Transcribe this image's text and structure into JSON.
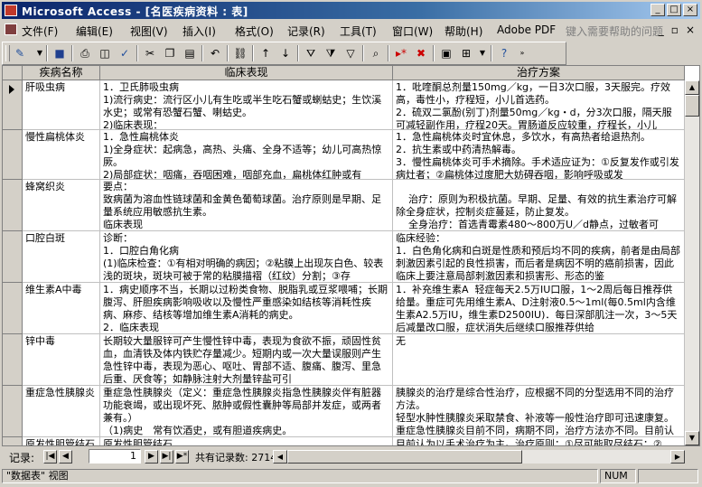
{
  "window": {
    "title": "Microsoft Access - [名医疾病资料 : 表]"
  },
  "menu": [
    "文件(F)",
    "编辑(E)",
    "视图(V)",
    "插入(I)",
    "格式(O)",
    "记录(R)",
    "工具(T)",
    "窗口(W)",
    "帮助(H)",
    "Adobe PDF"
  ],
  "help_placeholder": "键入需要帮助的问题",
  "toolbar": {
    "icons": [
      "design-view-icon",
      "save-icon",
      "print-icon",
      "print-preview-icon",
      "spelling-icon",
      "cut-icon",
      "copy-icon",
      "paste-icon",
      "undo-icon",
      "hyperlink-icon",
      "sort-ascending-icon",
      "sort-descending-icon",
      "filter-by-selection-icon",
      "filter-by-form-icon",
      "apply-filter-icon",
      "find-icon",
      "new-record-icon",
      "delete-record-icon",
      "database-window-icon",
      "new-object-icon",
      "help-icon"
    ]
  },
  "table": {
    "columns": [
      "疾病名称",
      "临床表现",
      "治疗方案"
    ],
    "rows": [
      {
        "name": "肝吸虫病",
        "clinical": "1．卫氏肺吸虫病\n1)流行病史：流行区小儿有生吃或半生吃石蟹或蝲蛄史；生饮溪水史；或常有恐蟹石蟹、喇蛄史。\n2)临床表现：",
        "treatment": "1．吡喹酮总剂量150mg／kg，一日3次口服，3天服完。疗效高，毒性小，疗程短，小儿首选药。\n2．硫双二氯酚(别丁)剂量50mg／kg・d，分3次口服，隔天服可减轻副作用，疗程20天。胃肠道反应较重，疗程长，小儿",
        "selected": true
      },
      {
        "name": "慢性扁桃体炎",
        "clinical": "1．急性扁桃体炎\n1)全身症状：起病急，高热、头痛、全身不适等；幼儿可高热惊厥。\n2)局部症状：咽痛，吞咽困难，咽部充血，扁桃体红肿或有",
        "treatment": "1．急性扁桃体炎时宜休息，多饮水，有高热者给退热剂。\n2．抗生素或中药清热解毒。\n3．慢性扁桃体炎可手术摘除。手术适应证为：①反复发作或引发病灶者；②扁桃体过度肥大妨碍吞咽，影响呼吸或发"
      },
      {
        "name": "蜂窝织炎",
        "clinical": "要点：\n致病菌为溶血性链球菌和金黄色葡萄球菌。治疗原则是早期、足量系统应用敏感抗生素。\n临床表现",
        "treatment": "\n    治疗：原则为积极抗菌。早期、足量、有效的抗生素治疗可解除全身症状，控制炎症蔓延，防止复发。\n    全身治疗：首选青霉素480～800万U／d静点，过敏者可"
      },
      {
        "name": "口腔白斑",
        "clinical": "诊断：\n1．口腔白角化病\n(1)临床检查：①有相对明确的病因；②粘膜上出现灰白色、较表浅的斑块，斑块可被于常的粘膜描褶（红纹）分割；③存",
        "treatment": "临床经验：\n1．白色角化病和白斑是性质和预后均不同的疾病，前者是由局部刺激因素引起的良性损害，而后者是病因不明的癌前损害，因此临床上要注意局部刺激因素和损害形、形态的鉴"
      },
      {
        "name": "维生素A中毒",
        "clinical": "1．病史顺序不当，长期以过粉类食物、脱脂乳或豆浆喂哺；长期腹泻、肝胆疾病影响吸收以及慢性严重感染如结核等消耗性疾病、麻疹、结核等增加维生素A消耗的病史。\n2．临床表现",
        "treatment": "1．补充维生素A  轻症每天2.5万IU口服，1～2周后每日推荐供给量。重症可先用维生素A、D注射液0.5～1ml(每0.5ml内含维生素A2.5万IU，维生素D2500IU)．每日深部肌注一次，3～5天后减量改口服，症状消失后继续口服推荐供给"
      },
      {
        "name": "锌中毒",
        "clinical": "长期较大量服锌可产生慢性锌中毒，表现为食欲不振，顽固性贫血，血清铁及体内铁贮存量减少。短期内或一次大量误服则产生急性锌中毒，表现为恶心、呕吐、胃部不适、腹痛、腹泻、里急后重、厌食等；如静脉注射大剂量锌盐可引",
        "treatment": "无"
      },
      {
        "name": "重症急性胰腺炎",
        "clinical": "重症急性胰腺炎（定义：重症急性胰腺炎指急性胰腺炎伴有脏器功能衰竭，或出现坏死、脓肿或假性囊肿等局部并发症，或两者兼有。）\n（1)病史　常有饮酒史，或有胆道疾病史。",
        "treatment": "胰腺炎的治疗是综合性治疗，应根据不同的分型选用不同的治疗方法。\n轻型水肿性胰腺炎采取禁食、补液等一般性治疗即可迅速康复。重症急性胰腺炎目前不同，病期不同，治疗方法亦不同。目前认为以手术治疗为主。治疗原则：①尽可能取尽结石；②"
      },
      {
        "name": "原发性胆管结石",
        "clinical": "原发性胆管结石",
        "treatment": "目前认为以手术治疗为主。治疗原则：①尽可能取尽结石；②"
      }
    ]
  },
  "navigation": {
    "label": "记录:",
    "current": "1",
    "count_text": "共有记录数: 2714"
  },
  "status": {
    "view_text": "\"数据表\" 视图",
    "num": "NUM"
  }
}
